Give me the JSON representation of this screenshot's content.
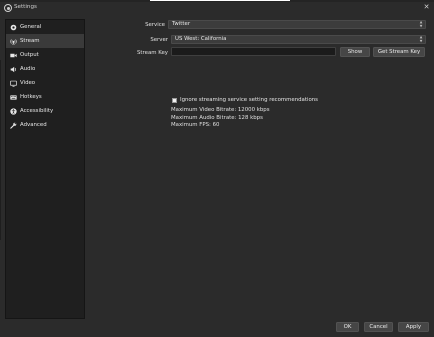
{
  "window": {
    "title": "Settings",
    "close_glyph": "✕"
  },
  "sidebar": {
    "items": [
      {
        "label": "General",
        "icon": "gear-icon",
        "active": false
      },
      {
        "label": "Stream",
        "icon": "antenna-icon",
        "active": true
      },
      {
        "label": "Output",
        "icon": "output-icon",
        "active": false
      },
      {
        "label": "Audio",
        "icon": "speaker-icon",
        "active": false
      },
      {
        "label": "Video",
        "icon": "monitor-icon",
        "active": false
      },
      {
        "label": "Hotkeys",
        "icon": "keyboard-icon",
        "active": false
      },
      {
        "label": "Accessibility",
        "icon": "accessibility-icon",
        "active": false
      },
      {
        "label": "Advanced",
        "icon": "wrench-icon",
        "active": false
      }
    ]
  },
  "stream": {
    "service_label": "Service",
    "service_value": "Twitter",
    "server_label": "Server",
    "server_value": "US West: California",
    "stream_key_label": "Stream Key",
    "stream_key_value": "",
    "show_button": "Show",
    "get_key_button": "Get Stream Key",
    "ignore_checkbox_label": "Ignore streaming service setting recommendations",
    "ignore_checked": false,
    "max_video_bitrate": "Maximum Video Bitrate: 12000 kbps",
    "max_audio_bitrate": "Maximum Audio Bitrate: 128 kbps",
    "max_fps": "Maximum FPS: 60"
  },
  "footer": {
    "ok": "OK",
    "cancel": "Cancel",
    "apply": "Apply"
  },
  "colors": {
    "background": "#2b2b2b",
    "sidebar": "#1f1f1f",
    "selected": "#3a3a3a",
    "button": "#464646"
  }
}
